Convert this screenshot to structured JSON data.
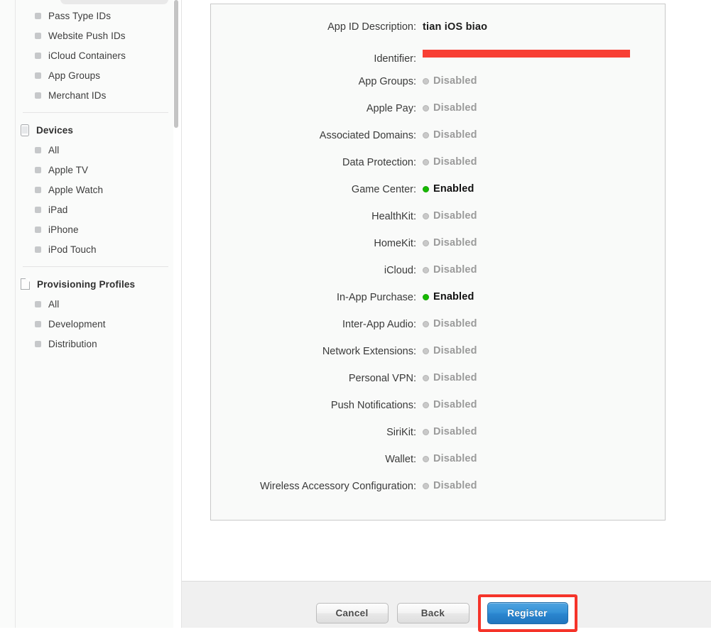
{
  "sidebar": {
    "groups": [
      {
        "header": null,
        "header_icon": null,
        "items": [
          {
            "label": "Pass Type IDs"
          },
          {
            "label": "Website Push IDs"
          },
          {
            "label": "iCloud Containers"
          },
          {
            "label": "App Groups"
          },
          {
            "label": "Merchant IDs"
          }
        ]
      },
      {
        "header": "Devices",
        "header_icon": "device-icon",
        "items": [
          {
            "label": "All"
          },
          {
            "label": "Apple TV"
          },
          {
            "label": "Apple Watch"
          },
          {
            "label": "iPad"
          },
          {
            "label": "iPhone"
          },
          {
            "label": "iPod Touch"
          }
        ]
      },
      {
        "header": "Provisioning Profiles",
        "header_icon": "document-icon",
        "items": [
          {
            "label": "All"
          },
          {
            "label": "Development"
          },
          {
            "label": "Distribution"
          }
        ]
      }
    ]
  },
  "detail": {
    "fields": [
      {
        "label": "App ID Description:",
        "type": "text",
        "value": "tian iOS biao"
      },
      {
        "label": "Identifier:",
        "type": "redacted",
        "value": ""
      },
      {
        "label": "App Groups:",
        "type": "status",
        "value": "Disabled",
        "enabled": false
      },
      {
        "label": "Apple Pay:",
        "type": "status",
        "value": "Disabled",
        "enabled": false
      },
      {
        "label": "Associated Domains:",
        "type": "status",
        "value": "Disabled",
        "enabled": false
      },
      {
        "label": "Data Protection:",
        "type": "status",
        "value": "Disabled",
        "enabled": false
      },
      {
        "label": "Game Center:",
        "type": "status",
        "value": "Enabled",
        "enabled": true
      },
      {
        "label": "HealthKit:",
        "type": "status",
        "value": "Disabled",
        "enabled": false
      },
      {
        "label": "HomeKit:",
        "type": "status",
        "value": "Disabled",
        "enabled": false
      },
      {
        "label": "iCloud:",
        "type": "status",
        "value": "Disabled",
        "enabled": false
      },
      {
        "label": "In-App Purchase:",
        "type": "status",
        "value": "Enabled",
        "enabled": true
      },
      {
        "label": "Inter-App Audio:",
        "type": "status",
        "value": "Disabled",
        "enabled": false
      },
      {
        "label": "Network Extensions:",
        "type": "status",
        "value": "Disabled",
        "enabled": false
      },
      {
        "label": "Personal VPN:",
        "type": "status",
        "value": "Disabled",
        "enabled": false
      },
      {
        "label": "Push Notifications:",
        "type": "status",
        "value": "Disabled",
        "enabled": false
      },
      {
        "label": "SiriKit:",
        "type": "status",
        "value": "Disabled",
        "enabled": false
      },
      {
        "label": "Wallet:",
        "type": "status",
        "value": "Disabled",
        "enabled": false
      },
      {
        "label": "Wireless Accessory Configuration:",
        "type": "status",
        "value": "Disabled",
        "enabled": false
      }
    ]
  },
  "footer": {
    "cancel_label": "Cancel",
    "back_label": "Back",
    "register_label": "Register"
  },
  "colors": {
    "enabled_dot": "#17b900",
    "disabled_dot": "#c9c9c9",
    "redaction_bar": "#f83f34",
    "highlight_outline": "#f5342a",
    "primary_button": "#2a85ce"
  }
}
